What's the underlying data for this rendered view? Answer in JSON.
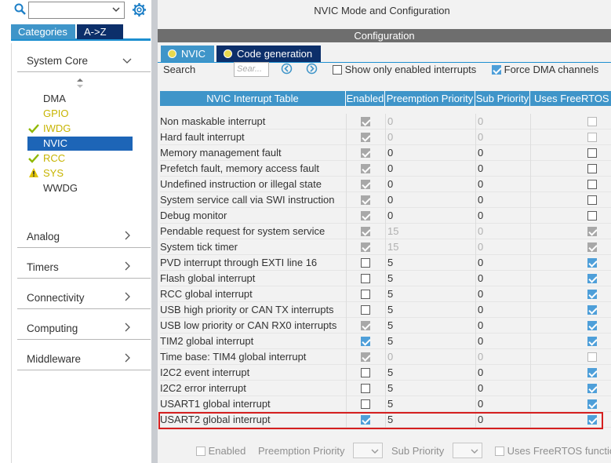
{
  "left": {
    "tabs": {
      "categories": "Categories",
      "az": "A->Z"
    },
    "categories": [
      {
        "label": "System Core",
        "expanded": true
      },
      {
        "label": "Analog"
      },
      {
        "label": "Timers"
      },
      {
        "label": "Connectivity"
      },
      {
        "label": "Computing"
      },
      {
        "label": "Middleware"
      }
    ],
    "peripherals": [
      {
        "label": "DMA",
        "status": "none",
        "color": "#333333"
      },
      {
        "label": "GPIO",
        "status": "none",
        "color": "#c7b400"
      },
      {
        "label": "IWDG",
        "status": "check",
        "color": "#c7b400"
      },
      {
        "label": "NVIC",
        "status": "selected",
        "color": "#ffffff"
      },
      {
        "label": "RCC",
        "status": "check",
        "color": "#c7b400"
      },
      {
        "label": "SYS",
        "status": "warning",
        "color": "#c7b400"
      },
      {
        "label": "WWDG",
        "status": "none",
        "color": "#333333"
      }
    ]
  },
  "right": {
    "title": "NVIC Mode and Configuration",
    "config_label": "Configuration",
    "tabs": {
      "nvic": "NVIC",
      "codegen": "Code generation"
    },
    "search_label": "Search",
    "search_placeholder": "Sear...",
    "show_only_enabled": "Show only enabled interrupts",
    "force_dma": "Force DMA channels",
    "columns": [
      "NVIC Interrupt Table",
      "Enabled",
      "Preemption Priority",
      "Sub Priority",
      "Uses FreeRTOS"
    ],
    "rows": [
      {
        "name": "Non maskable interrupt",
        "enabled": "fixed-on",
        "pp": "0",
        "sp": "0",
        "fr": "dis",
        "grey": true
      },
      {
        "name": "Hard fault interrupt",
        "enabled": "fixed-on",
        "pp": "0",
        "sp": "0",
        "fr": "dis",
        "grey": true
      },
      {
        "name": "Memory management fault",
        "enabled": "fixed-on",
        "pp": "0",
        "sp": "0",
        "fr": "off",
        "grey": false
      },
      {
        "name": "Prefetch fault, memory access fault",
        "enabled": "fixed-on",
        "pp": "0",
        "sp": "0",
        "fr": "off",
        "grey": false
      },
      {
        "name": "Undefined instruction or illegal state",
        "enabled": "fixed-on",
        "pp": "0",
        "sp": "0",
        "fr": "off",
        "grey": false
      },
      {
        "name": "System service call via SWI instruction",
        "enabled": "fixed-on",
        "pp": "0",
        "sp": "0",
        "fr": "off",
        "grey": false
      },
      {
        "name": "Debug monitor",
        "enabled": "fixed-on",
        "pp": "0",
        "sp": "0",
        "fr": "off",
        "grey": false
      },
      {
        "name": "Pendable request for system service",
        "enabled": "fixed-on",
        "pp": "15",
        "sp": "0",
        "fr": "dison",
        "grey": true
      },
      {
        "name": "System tick timer",
        "enabled": "fixed-on",
        "pp": "15",
        "sp": "0",
        "fr": "dison",
        "grey": true
      },
      {
        "name": "PVD interrupt through EXTI line 16",
        "enabled": "off",
        "pp": "5",
        "sp": "0",
        "fr": "on",
        "grey": false
      },
      {
        "name": "Flash global interrupt",
        "enabled": "off",
        "pp": "5",
        "sp": "0",
        "fr": "on",
        "grey": false
      },
      {
        "name": "RCC global interrupt",
        "enabled": "off",
        "pp": "5",
        "sp": "0",
        "fr": "on",
        "grey": false
      },
      {
        "name": "USB high priority or CAN TX interrupts",
        "enabled": "off",
        "pp": "5",
        "sp": "0",
        "fr": "on",
        "grey": false
      },
      {
        "name": "USB low priority or CAN RX0 interrupts",
        "enabled": "fixed-on",
        "pp": "5",
        "sp": "0",
        "fr": "on",
        "grey": false
      },
      {
        "name": "TIM2 global interrupt",
        "enabled": "on",
        "pp": "5",
        "sp": "0",
        "fr": "on",
        "grey": false
      },
      {
        "name": "Time base: TIM4 global interrupt",
        "enabled": "fixed-on",
        "pp": "0",
        "sp": "0",
        "fr": "dis",
        "grey": true
      },
      {
        "name": "I2C2 event interrupt",
        "enabled": "off",
        "pp": "5",
        "sp": "0",
        "fr": "on",
        "grey": false
      },
      {
        "name": "I2C2 error interrupt",
        "enabled": "off",
        "pp": "5",
        "sp": "0",
        "fr": "on",
        "grey": false
      },
      {
        "name": "USART1 global interrupt",
        "enabled": "off",
        "pp": "5",
        "sp": "0",
        "fr": "on",
        "grey": false
      },
      {
        "name": "USART2 global interrupt",
        "enabled": "on",
        "pp": "5",
        "sp": "0",
        "fr": "on",
        "grey": false,
        "highlighted": true
      }
    ],
    "bottom": {
      "enabled": "Enabled",
      "preemption": "Preemption Priority",
      "sub": "Sub Priority",
      "freertos": "Uses FreeRTOS functions"
    }
  },
  "colors": {
    "accent": "#3f95c9",
    "dark_tab": "#0c2f6a",
    "selected": "#1d65b7",
    "highlight": "#d51f1f",
    "warning": "#e0c400"
  }
}
